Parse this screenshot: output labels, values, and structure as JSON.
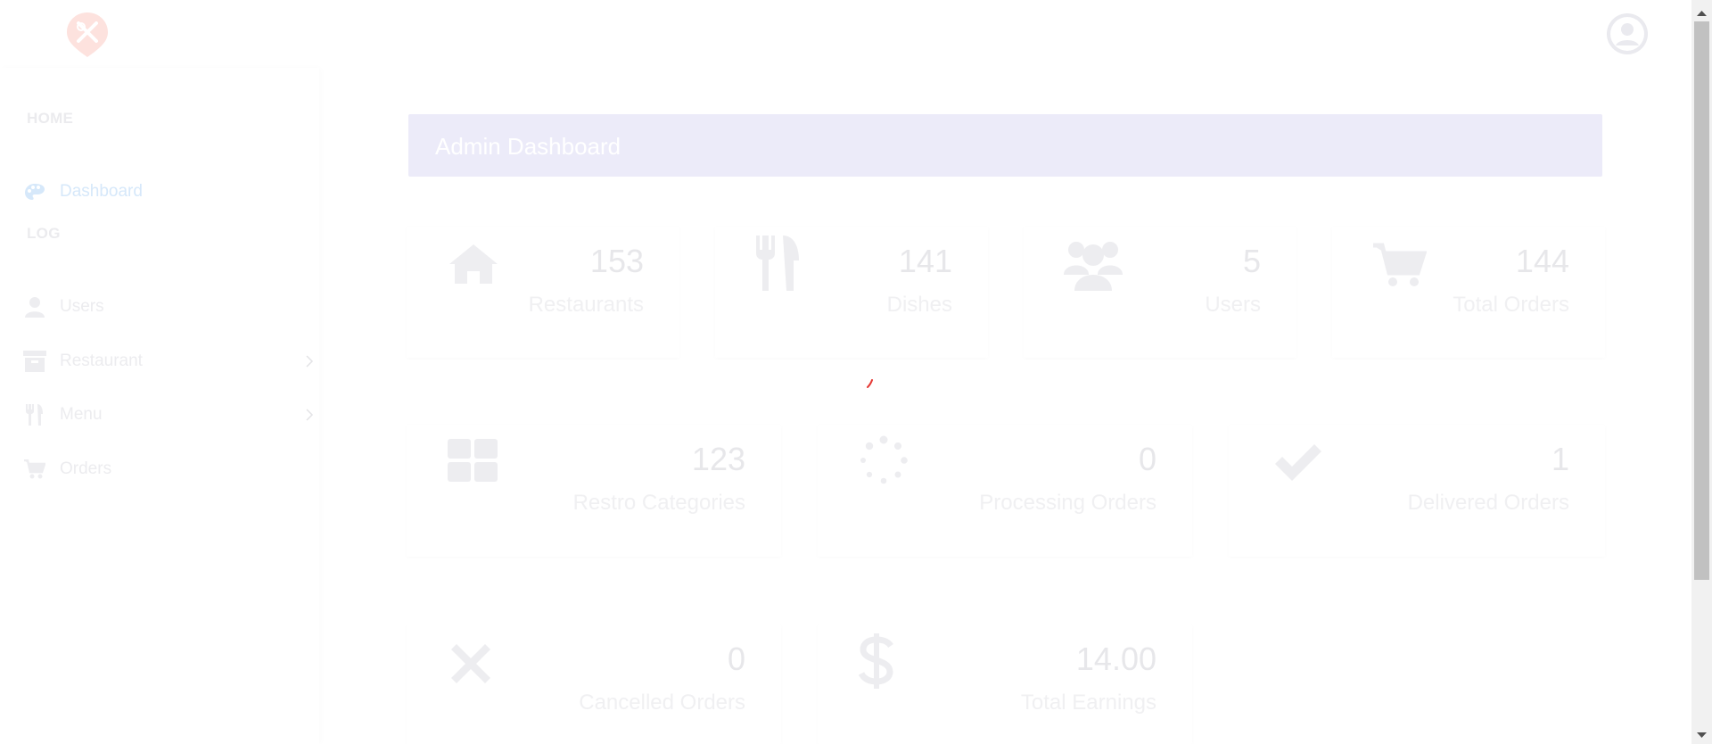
{
  "sidebar": {
    "sections": [
      {
        "heading": "HOME"
      },
      {
        "heading": "LOG"
      }
    ],
    "items": [
      {
        "label": "Dashboard",
        "icon": "palette-icon",
        "active": true
      },
      {
        "label": "Users",
        "icon": "user-icon"
      },
      {
        "label": "Restaurant",
        "icon": "archive-icon",
        "has_submenu": true
      },
      {
        "label": "Menu",
        "icon": "cutlery-icon",
        "has_submenu": true
      },
      {
        "label": "Orders",
        "icon": "cart-icon"
      }
    ]
  },
  "header": {
    "title": "Admin Dashboard"
  },
  "stats": [
    {
      "value": "153",
      "label": "Restaurants",
      "icon": "home-icon"
    },
    {
      "value": "141",
      "label": "Dishes",
      "icon": "cutlery-icon"
    },
    {
      "value": "5",
      "label": "Users",
      "icon": "users-icon"
    },
    {
      "value": "144",
      "label": "Total Orders",
      "icon": "cart-icon"
    },
    {
      "value": "123",
      "label": "Restro Categories",
      "icon": "grid-icon"
    },
    {
      "value": "0",
      "label": "Processing Orders",
      "icon": "spinner-icon"
    },
    {
      "value": "1",
      "label": "Delivered Orders",
      "icon": "check-icon"
    },
    {
      "value": "0",
      "label": "Cancelled Orders",
      "icon": "close-icon"
    },
    {
      "value": "14.00",
      "label": "Total Earnings",
      "icon": "dollar-icon"
    }
  ],
  "colors": {
    "logo": "#fde2de",
    "header_bg": "#ecebf9",
    "active_nav": "#d6e8fa",
    "loader_accent": "#e53935"
  }
}
